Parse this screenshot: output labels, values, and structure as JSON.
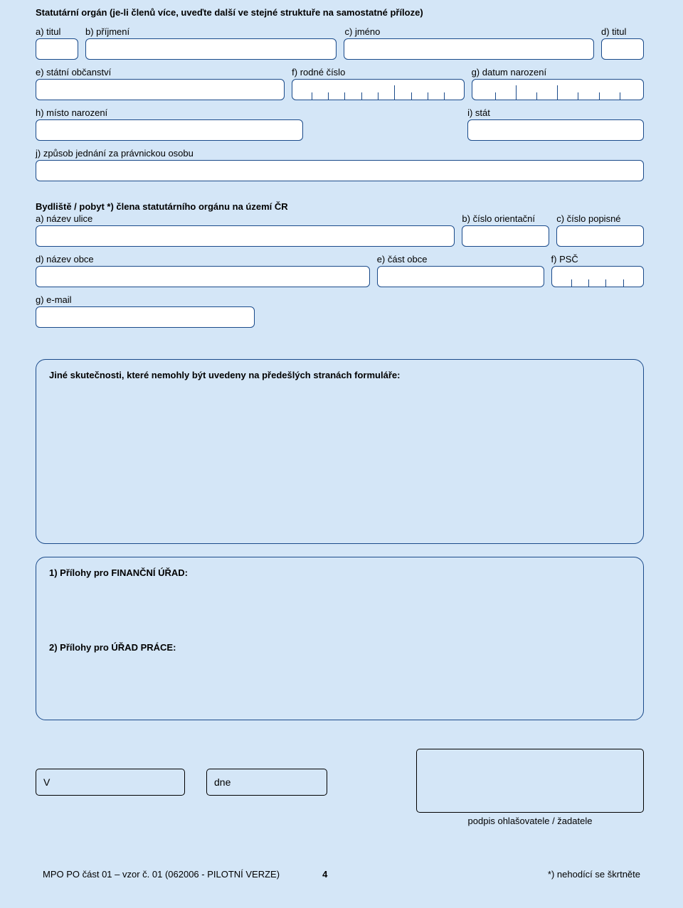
{
  "section_statutory": {
    "title": "Statutární orgán (je-li členů více, uveďte další ve stejné struktuře na samostatné příloze)",
    "a_titul": "a) titul",
    "b_prijmeni": "b) příjmení",
    "c_jmeno": "c) jméno",
    "d_titul": "d) titul",
    "e_obcanstvi": "e) státní občanství",
    "f_rodne_cislo": "f) rodné číslo",
    "g_datum_narozeni": "g) datum narození",
    "h_misto_narozeni": "h) místo narození",
    "i_stat": "i) stát",
    "j_zpusob": "j) způsob jednání za právnickou osobu"
  },
  "section_bydliste": {
    "title": "Bydliště / pobyt *) člena statutárního orgánu na území ČR",
    "a_ulice": "a) název ulice",
    "b_orientacni": "b) číslo orientační",
    "c_popisne": "c) číslo popisné",
    "d_obec": "d) název obce",
    "e_cast": "e) část obce",
    "f_psc": "f) PSČ",
    "g_email": "g) e-mail"
  },
  "jine": "Jiné skutečnosti, které nemohly být uvedeny na předešlých stranách formuláře:",
  "prilohy": {
    "p1": "1) Přílohy pro FINANČNÍ ÚŘAD:",
    "p2": "2) Přílohy pro ÚŘAD PRÁCE:"
  },
  "sig": {
    "v": "V",
    "dne": "dne",
    "caption": "podpis ohlašovatele / žadatele"
  },
  "footer": {
    "left": "MPO PO  část 01 – vzor č. 01 (062006 - PILOTNÍ VERZE)",
    "page": "4",
    "right": "*) nehodící se škrtněte"
  }
}
